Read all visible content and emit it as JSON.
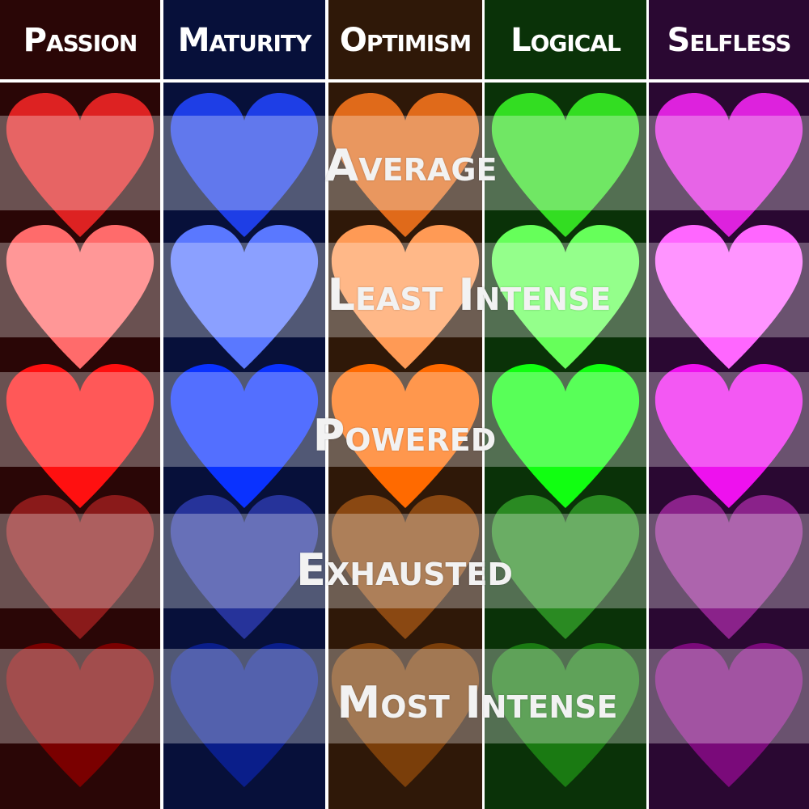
{
  "columns": [
    {
      "label": "Passion",
      "bg": "#2a0606",
      "hearts": [
        "#dd2222",
        "#ff6b6b",
        "#ff1010",
        "#8a1a1a",
        "#7a0000"
      ]
    },
    {
      "label": "Maturity",
      "bg": "#07103a",
      "hearts": [
        "#1e3ee6",
        "#5a78ff",
        "#0a32ff",
        "#26339a",
        "#0a1e8a"
      ]
    },
    {
      "label": "Optimism",
      "bg": "#2f1808",
      "hearts": [
        "#e06a1a",
        "#ff9a55",
        "#ff6a00",
        "#8a4812",
        "#7a3e0a"
      ]
    },
    {
      "label": "Logical",
      "bg": "#0a3208",
      "hearts": [
        "#33dd22",
        "#66ff5a",
        "#11ff11",
        "#2a8a22",
        "#1a7a12"
      ]
    },
    {
      "label": "Selfless",
      "bg": "#2a0832",
      "hearts": [
        "#dd22dd",
        "#ff66ff",
        "#ee11ee",
        "#8a228a",
        "#7a0a7a"
      ]
    }
  ],
  "rows": [
    {
      "label": "Average"
    },
    {
      "label": "Least Intense"
    },
    {
      "label": "Powered"
    },
    {
      "label": "Exhausted"
    },
    {
      "label": "Most Intense"
    }
  ],
  "colors": {
    "divider": "#ffffff",
    "band_overlay": "rgba(255,255,255,0.30)",
    "text": "#ffffff"
  },
  "icons": {
    "row_marker": "heart-icon"
  }
}
